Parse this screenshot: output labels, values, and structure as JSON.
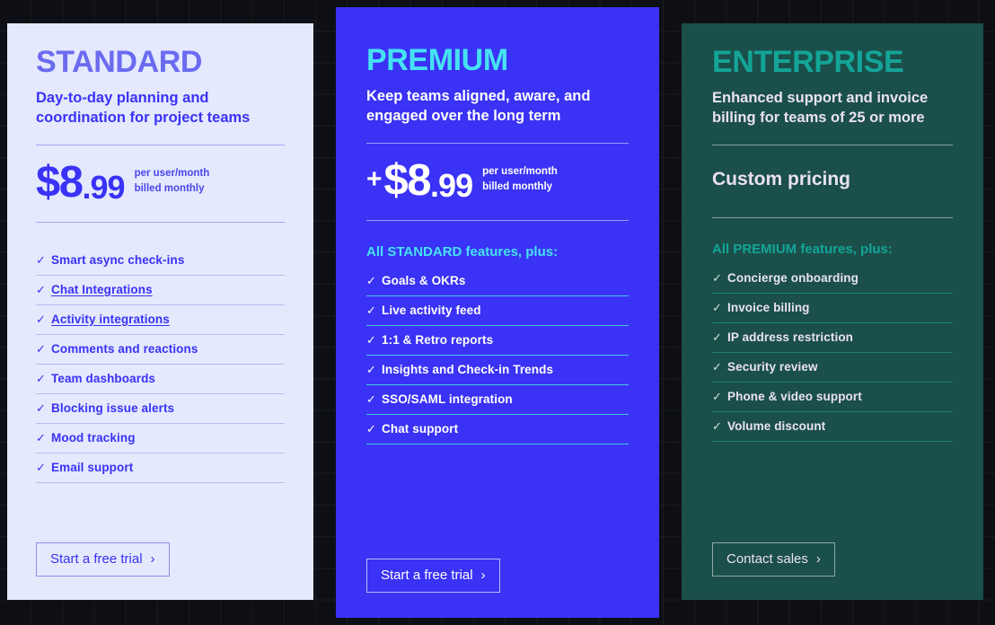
{
  "background": {
    "color": "#0d0f14",
    "grid": true
  },
  "plans": [
    {
      "id": "standard",
      "title": "STANDARD",
      "tagline": "Day-to-day planning and coordination for project teams",
      "price_plus": "",
      "price_main": "$8",
      "price_frac": ".99",
      "price_meta_line1": "per user/month",
      "price_meta_line2": "billed monthly",
      "section_heading": "",
      "features": [
        {
          "label": "Smart async check-ins",
          "link": false
        },
        {
          "label": "Chat Integrations",
          "link": true
        },
        {
          "label": "Activity integrations",
          "link": true
        },
        {
          "label": "Comments and reactions",
          "link": false
        },
        {
          "label": "Team dashboards",
          "link": false
        },
        {
          "label": "Blocking issue alerts",
          "link": false
        },
        {
          "label": "Mood tracking",
          "link": false
        },
        {
          "label": "Email support",
          "link": false
        }
      ],
      "cta_label": "Start a free trial",
      "cta_chevron": "›",
      "accent": "#6b6bf0",
      "background": "#e4e9fd"
    },
    {
      "id": "premium",
      "title": "PREMIUM",
      "tagline": "Keep teams aligned, aware, and engaged over the long term",
      "price_plus": "+",
      "price_main": "$8",
      "price_frac": ".99",
      "price_meta_line1": "per user/month",
      "price_meta_line2": "billed monthly",
      "section_heading": "All STANDARD features, plus:",
      "features": [
        {
          "label": "Goals & OKRs",
          "link": false
        },
        {
          "label": "Live activity feed",
          "link": false
        },
        {
          "label": "1:1 & Retro reports",
          "link": false
        },
        {
          "label": "Insights and Check-in Trends",
          "link": false
        },
        {
          "label": "SSO/SAML integration",
          "link": false
        },
        {
          "label": "Chat support",
          "link": false
        }
      ],
      "cta_label": "Start a free trial",
      "cta_chevron": "›",
      "accent": "#46e2f2",
      "background": "#3a32f5"
    },
    {
      "id": "enterprise",
      "title": "ENTERPRISE",
      "tagline": "Enhanced support and invoice billing for teams of 25 or more",
      "custom_price": "Custom pricing",
      "section_heading": "All PREMIUM features, plus:",
      "features": [
        {
          "label": "Concierge onboarding",
          "link": false
        },
        {
          "label": "Invoice billing",
          "link": false
        },
        {
          "label": "IP address restriction",
          "link": false
        },
        {
          "label": "Security review",
          "link": false
        },
        {
          "label": "Phone & video support",
          "link": false
        },
        {
          "label": "Volume discount",
          "link": false
        }
      ],
      "cta_label": "Contact sales",
      "cta_chevron": "›",
      "accent": "#13a598",
      "background": "#1b4f4a"
    }
  ],
  "icons": {
    "check": "✓",
    "chevron_right": "›"
  }
}
